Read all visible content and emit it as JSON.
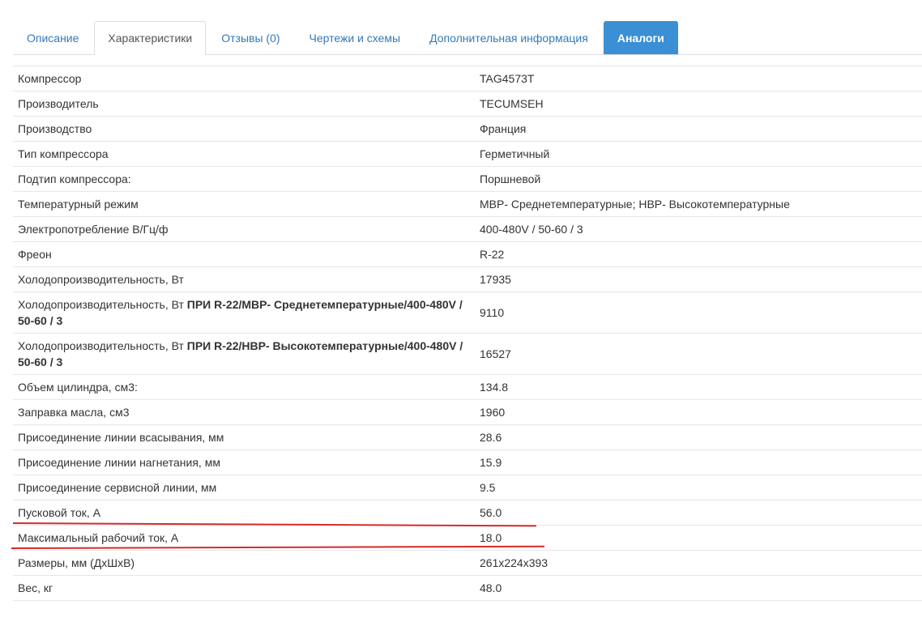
{
  "tabs": [
    {
      "label": "Описание"
    },
    {
      "label": "Характеристики"
    },
    {
      "label": "Отзывы (0)"
    },
    {
      "label": "Чертежи и схемы"
    },
    {
      "label": "Дополнительная информация"
    },
    {
      "label": "Аналоги"
    }
  ],
  "specs": [
    {
      "label": "Компрессор",
      "value": "TAG4573T"
    },
    {
      "label": "Производитель",
      "value": "TECUMSEH"
    },
    {
      "label": "Производство",
      "value": "Франция"
    },
    {
      "label": "Тип компрессора",
      "value": "Герметичный"
    },
    {
      "label": "Подтип компрессора:",
      "value": "Поршневой"
    },
    {
      "label": "Температурный режим",
      "value": "МВР- Среднетемпературные; НВР- Высокотемпературные"
    },
    {
      "label": "Электропотребление В/Гц/ф",
      "value": "400-480V / 50-60 / 3"
    },
    {
      "label": "Фреон",
      "value": "R-22"
    },
    {
      "label": "Холодопроизводительность, Вт",
      "value": "17935"
    },
    {
      "label": "Холодопроизводительность, Вт",
      "note": "ПРИ R-22/МВР- Среднетемпературные/400-480V / 50-60 / 3",
      "value": "9110"
    },
    {
      "label": "Холодопроизводительность, Вт",
      "note": "ПРИ R-22/НВР- Высокотемпературные/400-480V / 50-60 / 3",
      "value": "16527"
    },
    {
      "label": "Объем цилиндра, см3:",
      "value": "134.8"
    },
    {
      "label": "Заправка масла, см3",
      "value": "1960"
    },
    {
      "label": "Присоединение линии всасывания, мм",
      "value": "28.6"
    },
    {
      "label": "Присоединение линии нагнетания, мм",
      "value": "15.9"
    },
    {
      "label": "Присоединение сервисной линии, мм",
      "value": "9.5"
    },
    {
      "label": "Пусковой ток, А",
      "value": "56.0"
    },
    {
      "label": "Максимальный рабочий ток, А",
      "value": "18.0"
    },
    {
      "label": "Размеры, мм (ДхШхВ)",
      "value": "261x224x393"
    },
    {
      "label": "Вес, кг",
      "value": "48.0"
    }
  ],
  "colors": {
    "accent_tab": "#3b8fd5",
    "highlight_lines": "#d62b2b",
    "link": "#337ab7"
  }
}
